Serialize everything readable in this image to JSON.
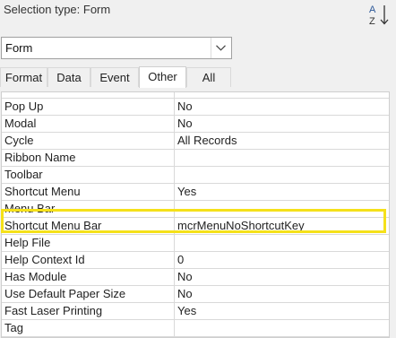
{
  "header": {
    "selection_type": "Selection type:  Form",
    "sort_icon": "sort-az-icon"
  },
  "object_selector": {
    "value": "Form",
    "icon": "chevron-down-icon"
  },
  "tabs": [
    {
      "label": "Format",
      "active": false
    },
    {
      "label": "Data",
      "active": false
    },
    {
      "label": "Event",
      "active": false
    },
    {
      "label": "Other",
      "active": true
    },
    {
      "label": "All",
      "active": false
    }
  ],
  "properties": [
    {
      "name": "Pop Up",
      "value": "No"
    },
    {
      "name": "Modal",
      "value": "No"
    },
    {
      "name": "Cycle",
      "value": "All Records"
    },
    {
      "name": "Ribbon Name",
      "value": ""
    },
    {
      "name": "Toolbar",
      "value": ""
    },
    {
      "name": "Shortcut Menu",
      "value": "Yes"
    },
    {
      "name": "Menu Bar",
      "value": ""
    },
    {
      "name": "Shortcut Menu Bar",
      "value": "mcrMenuNoShortcutKey"
    },
    {
      "name": "Help File",
      "value": ""
    },
    {
      "name": "Help Context Id",
      "value": "0"
    },
    {
      "name": "Has Module",
      "value": "No"
    },
    {
      "name": "Use Default Paper Size",
      "value": "No"
    },
    {
      "name": "Fast Laser Printing",
      "value": "Yes"
    },
    {
      "name": "Tag",
      "value": ""
    }
  ],
  "highlight_color": "#f5e11a"
}
